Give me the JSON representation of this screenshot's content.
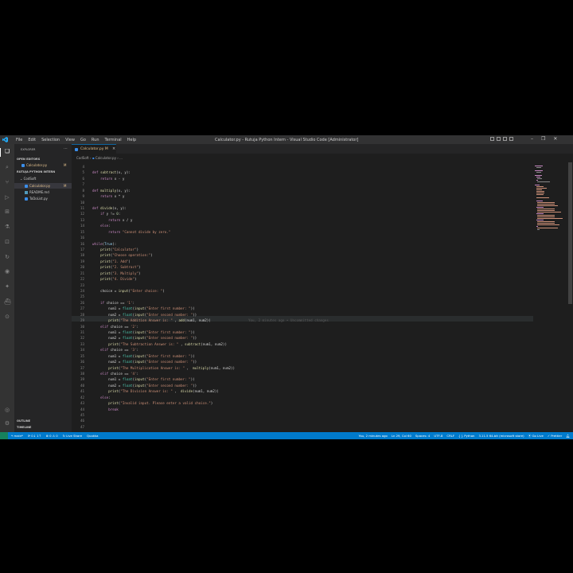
{
  "titlebar": {
    "menus": [
      "File",
      "Edit",
      "Selection",
      "View",
      "Go",
      "Run",
      "Terminal",
      "Help"
    ],
    "title": "Calculator.py - Rutuja Python Intern - Visual Studio Code [Administrator]"
  },
  "sidebar": {
    "title": "EXPLORER",
    "open_editors": "OPEN EDITORS",
    "open_file": "Calculator.py",
    "open_file_badge": "M",
    "workspace": "RUTUJA PYTHON INTERN",
    "folder": "CodSoft",
    "files": [
      {
        "name": "Calculator.py",
        "badge": "M"
      },
      {
        "name": "README.md",
        "badge": ""
      },
      {
        "name": "ToDoList.py",
        "badge": ""
      }
    ],
    "outline": "OUTLINE",
    "timeline": "TIMELINE"
  },
  "tab": {
    "label": "Calculator.py",
    "badge": "M",
    "close": "×"
  },
  "breadcrumb": {
    "folder": "CodSoft",
    "file": "Calculator.py",
    "tail": "..."
  },
  "code": {
    "blame": "You, 2 minutes ago • Uncommitted changes",
    "lines": [
      {
        "n": "4",
        "t": ""
      },
      {
        "n": "5",
        "t": "def subtract(x, y):"
      },
      {
        "n": "6",
        "t": "    return x - y"
      },
      {
        "n": "7",
        "t": ""
      },
      {
        "n": "8",
        "t": "def multiply(x, y):"
      },
      {
        "n": "9",
        "t": "    return x * y"
      },
      {
        "n": "10",
        "t": ""
      },
      {
        "n": "11",
        "t": "def divide(x, y):"
      },
      {
        "n": "12",
        "t": "    if y != 0:"
      },
      {
        "n": "13",
        "t": "        return x / y"
      },
      {
        "n": "14",
        "t": "    else:"
      },
      {
        "n": "15",
        "t": "        return \"Cannot divide by zero.\""
      },
      {
        "n": "16",
        "t": ""
      },
      {
        "n": "16",
        "t": "while(True):"
      },
      {
        "n": "17",
        "t": "    print(\"Calculator\")"
      },
      {
        "n": "18",
        "t": "    print(\"Choose operation:\")"
      },
      {
        "n": "19",
        "t": "    print(\"1. Add\")"
      },
      {
        "n": "20",
        "t": "    print(\"2. Subtract\")"
      },
      {
        "n": "21",
        "t": "    print(\"3. Multiply\")"
      },
      {
        "n": "22",
        "t": "    print(\"4. Divide\")"
      },
      {
        "n": "23",
        "t": ""
      },
      {
        "n": "24",
        "t": "    choice = input(\"Enter choice: \")"
      },
      {
        "n": "25",
        "t": ""
      },
      {
        "n": "26",
        "t": "    if choice == '1':"
      },
      {
        "n": "27",
        "t": "        num1 = float(input(\"Enter first number: \"))"
      },
      {
        "n": "28",
        "t": "        num2 = float(input(\"Enter second number: \"))"
      },
      {
        "n": "29",
        "t": "        print(\"The Addition Answer is: \" , add(num1, num2))"
      },
      {
        "n": "30",
        "t": "    elif choice == '2':"
      },
      {
        "n": "31",
        "t": "        num1 = float(input(\"Enter first number: \"))"
      },
      {
        "n": "32",
        "t": "        num2 = float(input(\"Enter second number: \"))"
      },
      {
        "n": "33",
        "t": "        print(\"The Subtraction Answer is: \" , subtract(num1, num2))"
      },
      {
        "n": "34",
        "t": "    elif choice == '3':"
      },
      {
        "n": "35",
        "t": "        num1 = float(input(\"Enter first number: \"))"
      },
      {
        "n": "36",
        "t": "        num2 = float(input(\"Enter second number: \"))"
      },
      {
        "n": "37",
        "t": "        print(\"The Multiplication Answer is: \" ,  multiply(num1, num2))"
      },
      {
        "n": "38",
        "t": "    elif choice == '4':"
      },
      {
        "n": "39",
        "t": "        num1 = float(input(\"Enter first number: \"))"
      },
      {
        "n": "40",
        "t": "        num2 = float(input(\"Enter second number: \"))"
      },
      {
        "n": "41",
        "t": "        print(\"The Division Answer is: \" ,  divide(num1, num2))"
      },
      {
        "n": "42",
        "t": "    else:"
      },
      {
        "n": "43",
        "t": "        print(\"Invalid input. Please enter a valid choice.\")"
      },
      {
        "n": "44",
        "t": "        break"
      },
      {
        "n": "45",
        "t": ""
      },
      {
        "n": "46",
        "t": ""
      },
      {
        "n": "47",
        "t": ""
      }
    ]
  },
  "status": {
    "branch": "main*",
    "sync": "⟳ 0↓ 1↑",
    "problems": "⊗ 0 ⚠ 0",
    "live_share": "Live Share",
    "quokka": "Quokka",
    "blame": "You, 2 minutes ago",
    "position": "Ln 29, Col 60",
    "spaces": "Spaces: 4",
    "encoding": "UTF-8",
    "eol": "CRLF",
    "language": "Python",
    "interpreter": "3.11.5 64-bit (microsoft store)",
    "golive": "Go Live",
    "prettier": "Prettier"
  },
  "colors": {
    "accent": "#007acc",
    "activity": "#333333",
    "sidebar": "#252526",
    "editor": "#1e1e1e"
  }
}
